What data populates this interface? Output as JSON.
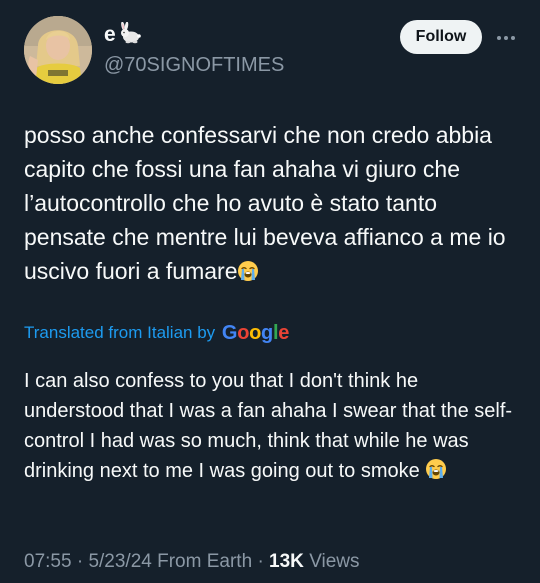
{
  "author": {
    "display_name": "e",
    "handle": "@70SIGNOFTIMES",
    "name_emoji": "rabbit-icon"
  },
  "actions": {
    "follow_label": "Follow",
    "more_icon": "more-horizontal-icon"
  },
  "tweet": {
    "text": "posso anche confessarvi che non credo abbia capito che fossi una fan ahaha vi giuro che l’autocontrollo che ho avuto è stato tanto pensate che mentre lui beveva affianco a me io uscivo fuori a fumare",
    "text_emoji": "loudly-crying-face-icon"
  },
  "translation": {
    "label": "Translated from Italian by",
    "provider": "Google",
    "text": "I can also confess to you that I don't think he understood that I was a fan ahaha I swear that the self-control I had was so much, think that while he was drinking next to me I was going out to smoke",
    "text_emoji": "loudly-crying-face-icon"
  },
  "meta": {
    "time": "07:55",
    "separator": "·",
    "date": "5/23/24",
    "source": "From Earth",
    "views_count": "13K",
    "views_label": "Views"
  },
  "colors": {
    "background": "#15202b",
    "text": "#f7f9f9",
    "secondary": "#8b98a5",
    "link": "#1d9bf0"
  }
}
